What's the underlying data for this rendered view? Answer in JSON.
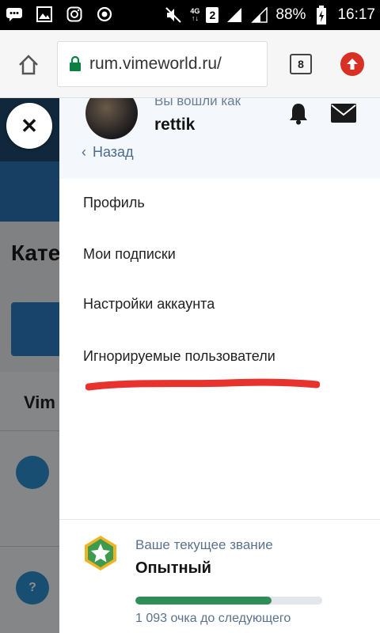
{
  "status_bar": {
    "net_type": "4G",
    "net_sub": "↑↓",
    "sim_slot": "2",
    "battery": "88%",
    "time": "16:17"
  },
  "browser": {
    "url": "rum.vimeworld.ru/",
    "tab_count": "8"
  },
  "background_page": {
    "heading_partial": "Кате",
    "section_partial": "Vim",
    "help_glyph": "?"
  },
  "drawer": {
    "logged_in_as": "Вы вошли как",
    "username": "rettik",
    "back_label": "Назад",
    "menu": [
      {
        "label": "Профиль"
      },
      {
        "label": "Мои подписки"
      },
      {
        "label": "Настройки аккаунта"
      },
      {
        "label": "Игнорируемые пользователи"
      }
    ],
    "rank": {
      "label": "Ваше текущее звание",
      "name": "Опытный",
      "progress_fraction": 0.73,
      "points_text": "1 093 очка до следующего"
    }
  },
  "colors": {
    "accent": "#2a73b4",
    "progress": "#2f8d5a",
    "scribble": "#e8322e"
  }
}
